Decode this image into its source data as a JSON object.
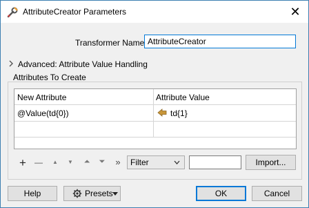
{
  "window": {
    "title": "AttributeCreator Parameters",
    "icon": "wrench-icon",
    "close_glyph": "✕"
  },
  "transformer_name": {
    "label": "Transformer Name:",
    "value": "AttributeCreator"
  },
  "advanced": {
    "label": "Advanced: Attribute Value Handling",
    "icon": "chevron-right-icon"
  },
  "attributes": {
    "group_label": "Attributes To Create",
    "columns": [
      "New Attribute",
      "Attribute Value"
    ],
    "rows": [
      {
        "new_attribute": "@Value(td{0})",
        "value_icon": "attribute-value-arrow-icon",
        "attribute_value": "td{1}"
      }
    ]
  },
  "toolbar": {
    "add_glyph": "+",
    "remove_glyph": "—",
    "up_glyph": "▲",
    "down_glyph": "▼",
    "top_glyph": "⏶",
    "bottom_glyph": "⏷",
    "more_glyph": "»",
    "filter_value": "Filter",
    "filter_text": "",
    "import_label": "Import..."
  },
  "buttons": {
    "help": "Help",
    "presets": "Presets",
    "ok": "OK",
    "cancel": "Cancel"
  },
  "colors": {
    "accent": "#0078d7",
    "arrow_icon": "#c8963a"
  }
}
